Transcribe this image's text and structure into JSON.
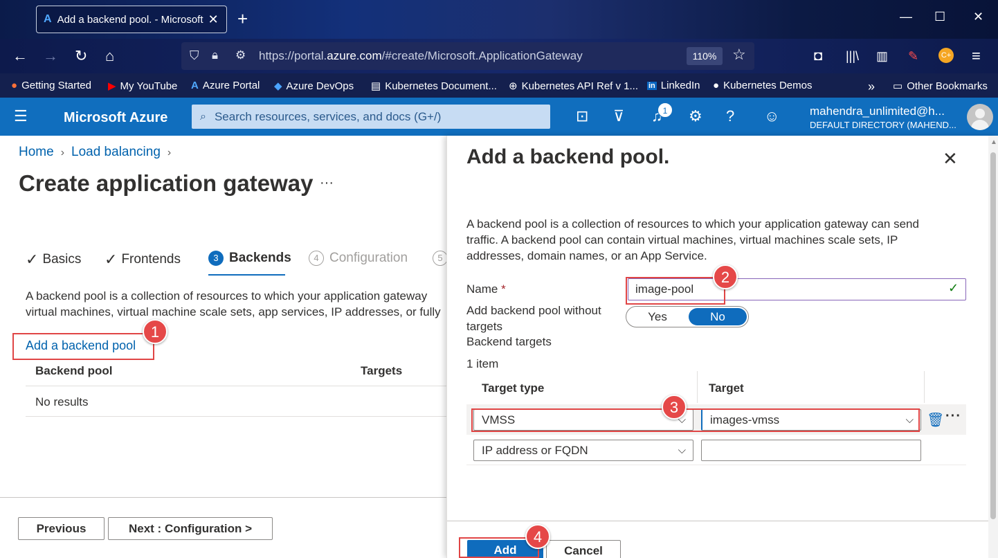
{
  "browser": {
    "tab_title": "Add a backend pool. - Microsoft Azure",
    "tab_close": "✕",
    "new_tab": "+",
    "url_prefix": "https://portal.",
    "url_host": "azure.com",
    "url_path": "/#create/Microsoft.ApplicationGateway",
    "zoom": "110%",
    "window_controls": [
      "—",
      "☐",
      "✕"
    ]
  },
  "bookmarks": [
    {
      "label": "Getting Started",
      "icon": "firefox-icon"
    },
    {
      "label": "My YouTube",
      "icon": "youtube-icon"
    },
    {
      "label": "Azure Portal",
      "icon": "azure-icon"
    },
    {
      "label": "Azure DevOps",
      "icon": "devops-icon"
    },
    {
      "label": "Kubernetes Document...",
      "icon": "page-icon"
    },
    {
      "label": "Kubernetes API Ref v 1...",
      "icon": "globe-icon"
    },
    {
      "label": "LinkedIn",
      "icon": "linkedin-icon"
    },
    {
      "label": "Kubernetes Demos",
      "icon": "github-icon"
    },
    {
      "label": "Other Bookmarks",
      "icon": "folder-icon"
    }
  ],
  "azure_header": {
    "brand": "Microsoft Azure",
    "search_placeholder": "Search resources, services, and docs (G+/)",
    "notification_count": "1",
    "account_name": "mahendra_unlimited@h...",
    "account_directory": "DEFAULT DIRECTORY (MAHEND..."
  },
  "page": {
    "breadcrumb": [
      "Home",
      "Load balancing"
    ],
    "title": "Create application gateway",
    "more": "···",
    "steps": [
      {
        "label": "Basics",
        "state": "done"
      },
      {
        "label": "Frontends",
        "state": "done"
      },
      {
        "label": "Backends",
        "number": "3",
        "state": "active"
      },
      {
        "label": "Configuration",
        "number": "4",
        "state": "pending"
      },
      {
        "label": "",
        "number": "5",
        "state": "pending"
      }
    ],
    "description_line1": "A backend pool is a collection of resources to which your application gateway",
    "description_line2": "virtual machines, virtual machine scale sets, app services, IP addresses, or fully",
    "add_pool_link": "Add a backend pool",
    "table_headers": [
      "Backend pool",
      "Targets"
    ],
    "empty_text": "No results",
    "previous_button": "Previous",
    "next_button": "Next : Configuration >"
  },
  "panel": {
    "title": "Add a backend pool.",
    "close": "✕",
    "description": "A backend pool is a collection of resources to which your application gateway can send traffic. A backend pool can contain virtual machines, virtual machines scale sets, IP addresses, domain names, or an App Service.",
    "name_label": "Name",
    "required_mark": "*",
    "name_value": "image-pool",
    "without_targets_label": "Add backend pool without targets",
    "toggle_yes": "Yes",
    "toggle_no": "No",
    "toggle_selected": "No",
    "backend_targets_label": "Backend targets",
    "item_count": "1 item",
    "col_target_type": "Target type",
    "col_target": "Target",
    "rows": [
      {
        "target_type": "VMSS",
        "target": "images-vmss"
      },
      {
        "target_type": "IP address or FQDN",
        "target": ""
      }
    ],
    "add_button": "Add",
    "cancel_button": "Cancel"
  },
  "callouts": [
    "1",
    "2",
    "3",
    "4"
  ],
  "colors": {
    "azure_blue": "#106ebe",
    "primary_button": "#0f6cbd",
    "callout_red": "#e54848",
    "link": "#0062ad"
  }
}
